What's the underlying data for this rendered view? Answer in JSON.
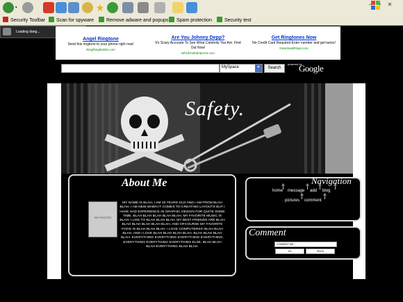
{
  "toolbar2": {
    "items": [
      {
        "label": "Security Toolbar"
      },
      {
        "label": "Scan for spyware"
      },
      {
        "label": "Remove adware and popups"
      },
      {
        "label": "Spam protection"
      },
      {
        "label": "Security test"
      }
    ]
  },
  "loading": {
    "text": "Loading dang..."
  },
  "ads": [
    {
      "headline": "Angel Ringtone",
      "text": "Send this ringtone to your phone right now!",
      "url": "RingRingMobile.com"
    },
    {
      "headline": "Are You Johnny Depp?",
      "text": "It's Scary Accurate To See What Celebrity You Are. Find Out Now!",
      "url": "WhichCelebrityAmI.com"
    },
    {
      "headline": "Get Ringtones Now",
      "text": "No Credit Card Required Enter number and get tunes!",
      "url": "DownloadRings.com"
    }
  ],
  "search": {
    "input_value": "",
    "select_value": "MySpace",
    "button_label": "Search",
    "powered_by": "powered by",
    "google": "Google"
  },
  "profile": {
    "title": "Safety.",
    "about": {
      "heading": "About Me",
      "photo_caption": "NO PHOTO",
      "text": "MY NAME IS BLAH, I AM 18 YEARS OLD AND I AM FROM BLAH BLAH. I AM NEW WHEN IT COMES TO CREATING LAYOUTS BUT I HAVE HAD EXPERIENCE IN GRAPHIC DESIGN FOR QUITE SOME TIME. BLAH BLAH BLAH BLAH BLAH. MY FAVORITE MUSIC IS BLAH. I LIKE TO BLAH BLAH BLAH. MY BEST FRIENDS ARE BLAH BLAH BLAH BLAH BLAH BLAH. AND OFCOURSE MY FAVORITE FOOD IS BLAH BLAH BLAH. I LOVE COMPUTERS!!! BLAH BLAH BLAH. AND I LOVE BLAH BLAH BLAH BLAH. BLAH BLAH BLAH BLAH. EVERYTHING EVERYTHING EVERYTHING EVERYTHING. EVERYTHING EVERYTHING EVERYTHING ELSE. BLAH BLAH BLAH EVERYTHING BLAH BLAH."
    },
    "navigation": {
      "heading": "Navigation",
      "links": [
        "home",
        "message",
        "add",
        "blog",
        "pictures",
        "comment"
      ]
    },
    "comment": {
      "heading": "Comment",
      "select_value": "COMMENT ME...",
      "button_1": "111",
      "button_2": "99/1/A"
    }
  },
  "colors": {
    "background": "#000000",
    "chrome": "#ece9d8",
    "link": "#0033cc",
    "ad_url": "#008000",
    "toolbar_check": "#3a9b2d"
  },
  "icons": [
    "back-arrow-icon",
    "forward-arrow-icon",
    "stop-icon",
    "refresh-icon",
    "home-icon",
    "search-icon",
    "favorites-star-icon",
    "history-icon",
    "mail-icon",
    "print-icon",
    "edit-icon",
    "folder-icon",
    "shield-icon",
    "windows-logo-icon",
    "skull-icon",
    "safety-pin-icon",
    "cross-icon"
  ]
}
